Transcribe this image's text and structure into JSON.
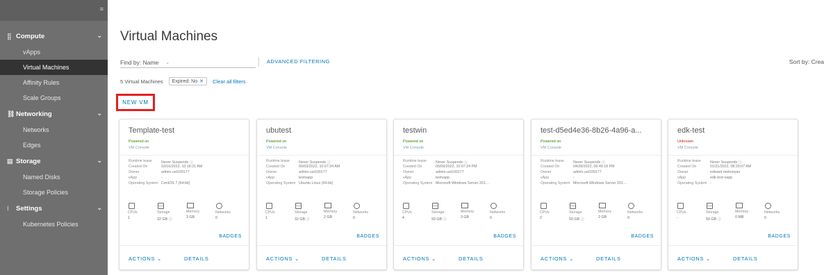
{
  "sidebar": {
    "collapse_icon": "collapse-icon",
    "groups": [
      {
        "label": "Compute",
        "items": [
          "vApps",
          "Virtual Machines",
          "Affinity Rules",
          "Scale Groups"
        ]
      },
      {
        "label": "Networking",
        "items": [
          "Networks",
          "Edges"
        ]
      },
      {
        "label": "Storage",
        "items": [
          "Named Disks",
          "Storage Policies"
        ]
      },
      {
        "label": "Settings",
        "items": [
          "Kubernetes Policies"
        ]
      }
    ],
    "active_item": "Virtual Machines"
  },
  "main": {
    "title": "Virtual Machines",
    "find_by": "Find by: Name",
    "advanced_filtering": "ADVANCED FILTERING",
    "sort_by": "Sort by: Crea",
    "count_text": "5 Virtual Machines",
    "filter_chip": "Expired: No",
    "clear_all": "Clear all filters",
    "new_vm": "NEW VM"
  },
  "card_labels": {
    "runtime_lease": "Runtime lease",
    "created_on": "Created On",
    "owner": "Owner",
    "vapp": "vApp",
    "os": "Operating System",
    "cpus": "CPUs",
    "storage": "Storage",
    "memory": "Memory",
    "networks": "Networks",
    "badges": "BADGES",
    "actions": "ACTIONS ⌄",
    "details": "DETAILS"
  },
  "cards": [
    {
      "title": "Template-test",
      "status": "Powered on",
      "console": "VM Console",
      "runtime_lease": "Never Suspends ⓘ",
      "created_on": "03/16/2022, 10:18:31 AM",
      "owner": "admin.ust100177",
      "vapp": "-",
      "os": "CentOS 7 (64-bit)",
      "cpus": "1",
      "storage": "32 GB ⓘ",
      "memory": "3 GB",
      "networks": "0"
    },
    {
      "title": "ubutest",
      "status": "Powered on",
      "console": "VM Console",
      "runtime_lease": "Never Suspends ⓘ",
      "created_on": "06/03/2022, 10:07:34 AM",
      "owner": "admin.ust100177",
      "vapp": "testvapp",
      "os": "Ubuntu Linux (64-bit)",
      "cpus": "1",
      "storage": "32 GB ⓘ",
      "memory": "2 GB",
      "networks": "0"
    },
    {
      "title": "testwin",
      "status": "Powered on",
      "console": "VM Console",
      "runtime_lease": "Never Suspends ⓘ",
      "created_on": "05/09/2022, 10:07:24 PM",
      "owner": "admin.ust100177",
      "vapp": "testvapp",
      "os": "Microsoft Windows Server 201…",
      "cpus": "4",
      "storage": "93 GB ⓘ",
      "memory": "3 GB",
      "networks": "0"
    },
    {
      "title": "test-d5ed4e36-8b26-4a96-a...",
      "status": "Powered on",
      "console": "VM Console",
      "runtime_lease": "Never Suspends ⓘ",
      "created_on": "04/28/2022, 09:49:18 PM",
      "owner": "admin.ust100177",
      "vapp": "-",
      "os": "Microsoft Windows Server 201…",
      "cpus": "2",
      "storage": "50 GB ⓘ",
      "memory": "2 GB",
      "networks": "0"
    },
    {
      "title": "edk-test",
      "status": "Unknown",
      "console": "VM Console",
      "runtime_lease": "Never Suspends ⓘ",
      "created_on": "01/21/2022, 08:29:07 AM",
      "owner": "edward.mekonyan",
      "vapp": "edk-test-vapp",
      "os": "-",
      "cpus": "-",
      "storage": "50 GB ⓘ",
      "memory": "0 MB",
      "networks": "0"
    }
  ],
  "colors": {
    "sidebar_bg": "#6f6f6f",
    "active_bg": "#333333",
    "link": "#0079b8",
    "highlight": "#e32020",
    "powered_on": "#2f8400",
    "unknown": "#c92100"
  }
}
